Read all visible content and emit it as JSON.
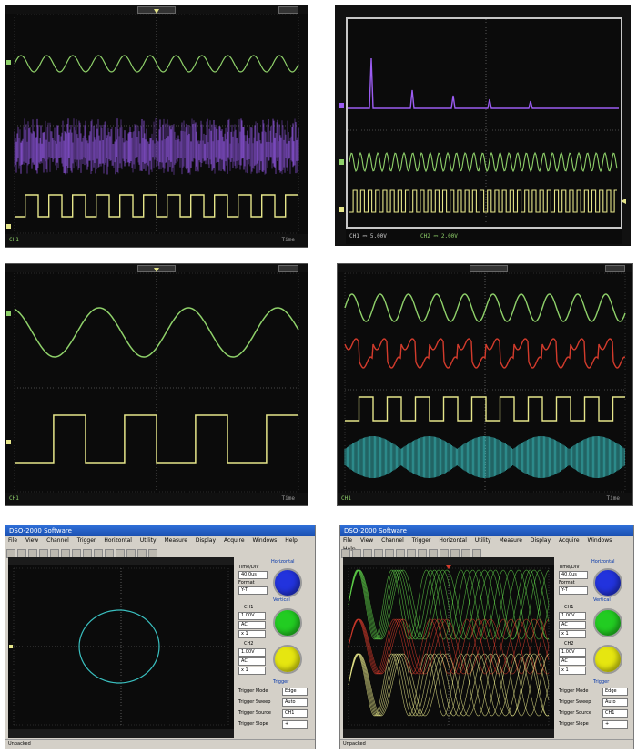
{
  "panel1": {
    "status_left": "CH1",
    "status_right": "Time"
  },
  "panel2": {
    "status_ch1": "CH1 ⎓ 5.00V",
    "status_ch2": "CH2 ⎓ 2.00V"
  },
  "panel3": {
    "status_left": "CH1",
    "status_right": "Time"
  },
  "panel4": {
    "status_left": "CH1",
    "status_right": "Time"
  },
  "app": {
    "title": "DSO-2000 Software",
    "menu": [
      "File",
      "View",
      "Channel",
      "Trigger",
      "Horizontal",
      "Utility",
      "Measure",
      "Display",
      "Acquire",
      "Windows",
      "Help"
    ],
    "status_text": "Unpacked",
    "labels": {
      "horizontal": "Horizontal",
      "time_div": "Time/DIV",
      "time_value": "40.0us",
      "format": "Format",
      "format_value": "Y-T",
      "vertical": "Vertical",
      "ch1": "CH1",
      "ch2": "CH2",
      "volt1": "1.00V",
      "volt2": "1.00V",
      "coupling": "AC",
      "probe": "x 1",
      "trigger": "Trigger",
      "trig_mode": "Trigger Mode",
      "trig_mode_val": "Edge",
      "trig_sweep": "Trigger Sweep",
      "trig_sweep_val": "Auto",
      "trig_source": "Trigger Source",
      "trig_source_val": "CH1",
      "trig_slope": "Trigger Slope",
      "trig_slope_val": "+"
    }
  },
  "colors": {
    "green": "#8fd16a",
    "purple": "#9b5cf2",
    "yellow": "#e6e68a",
    "red": "#d33b2c",
    "cyan": "#3ac0c0",
    "grid": "#555555"
  }
}
